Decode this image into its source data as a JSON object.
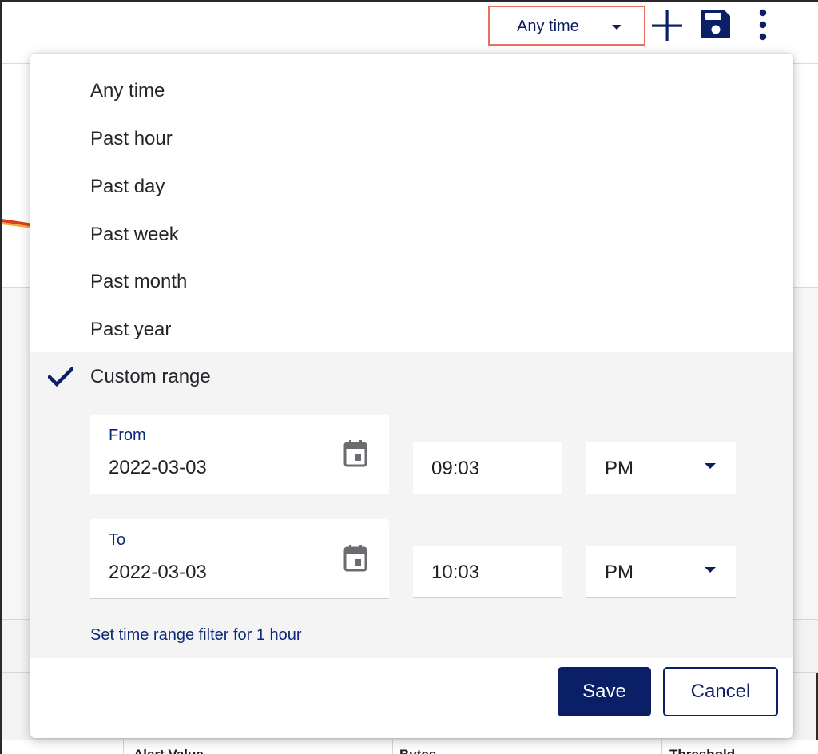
{
  "toolbar": {
    "time_filter_label": "Any time",
    "icons": [
      "plus-icon",
      "save-icon",
      "more-vertical-icon"
    ],
    "accent_color": "#0b1f66",
    "focus_outline_color": "#ea6e61"
  },
  "background": {
    "table_headers": [
      "Alert Value",
      "Bytes",
      "Threshold"
    ]
  },
  "menu": {
    "options": [
      "Any time",
      "Past hour",
      "Past day",
      "Past week",
      "Past month",
      "Past year"
    ],
    "custom": {
      "label": "Custom range",
      "selected": true,
      "from": {
        "label": "From",
        "date": "2022-03-03",
        "time": "09:03",
        "ampm": "PM"
      },
      "to": {
        "label": "To",
        "date": "2022-03-03",
        "time": "10:03",
        "ampm": "PM"
      },
      "quick_link": "Set time range filter for 1 hour"
    },
    "buttons": {
      "save": "Save",
      "cancel": "Cancel"
    }
  }
}
